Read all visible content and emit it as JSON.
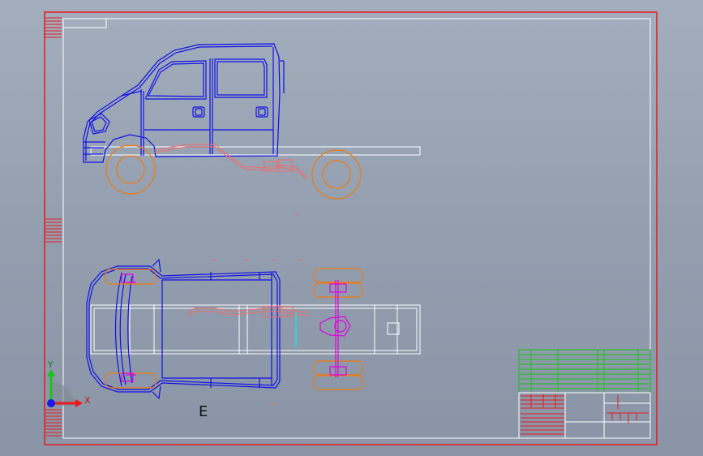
{
  "drawing": {
    "view_letter": "E",
    "axis": {
      "y_label": "Y",
      "x_label": "X"
    }
  },
  "colors": {
    "frame": "#e8191e",
    "body": "#1010e6",
    "chassis": "#ffffff",
    "wheels": "#f07a10",
    "exhaust": "#f26b6b",
    "axle": "#e000e0",
    "table_green": "#19c219",
    "axis_green": "#19c219",
    "axis_red": "#e81919",
    "axis_blue": "#1919e8"
  }
}
